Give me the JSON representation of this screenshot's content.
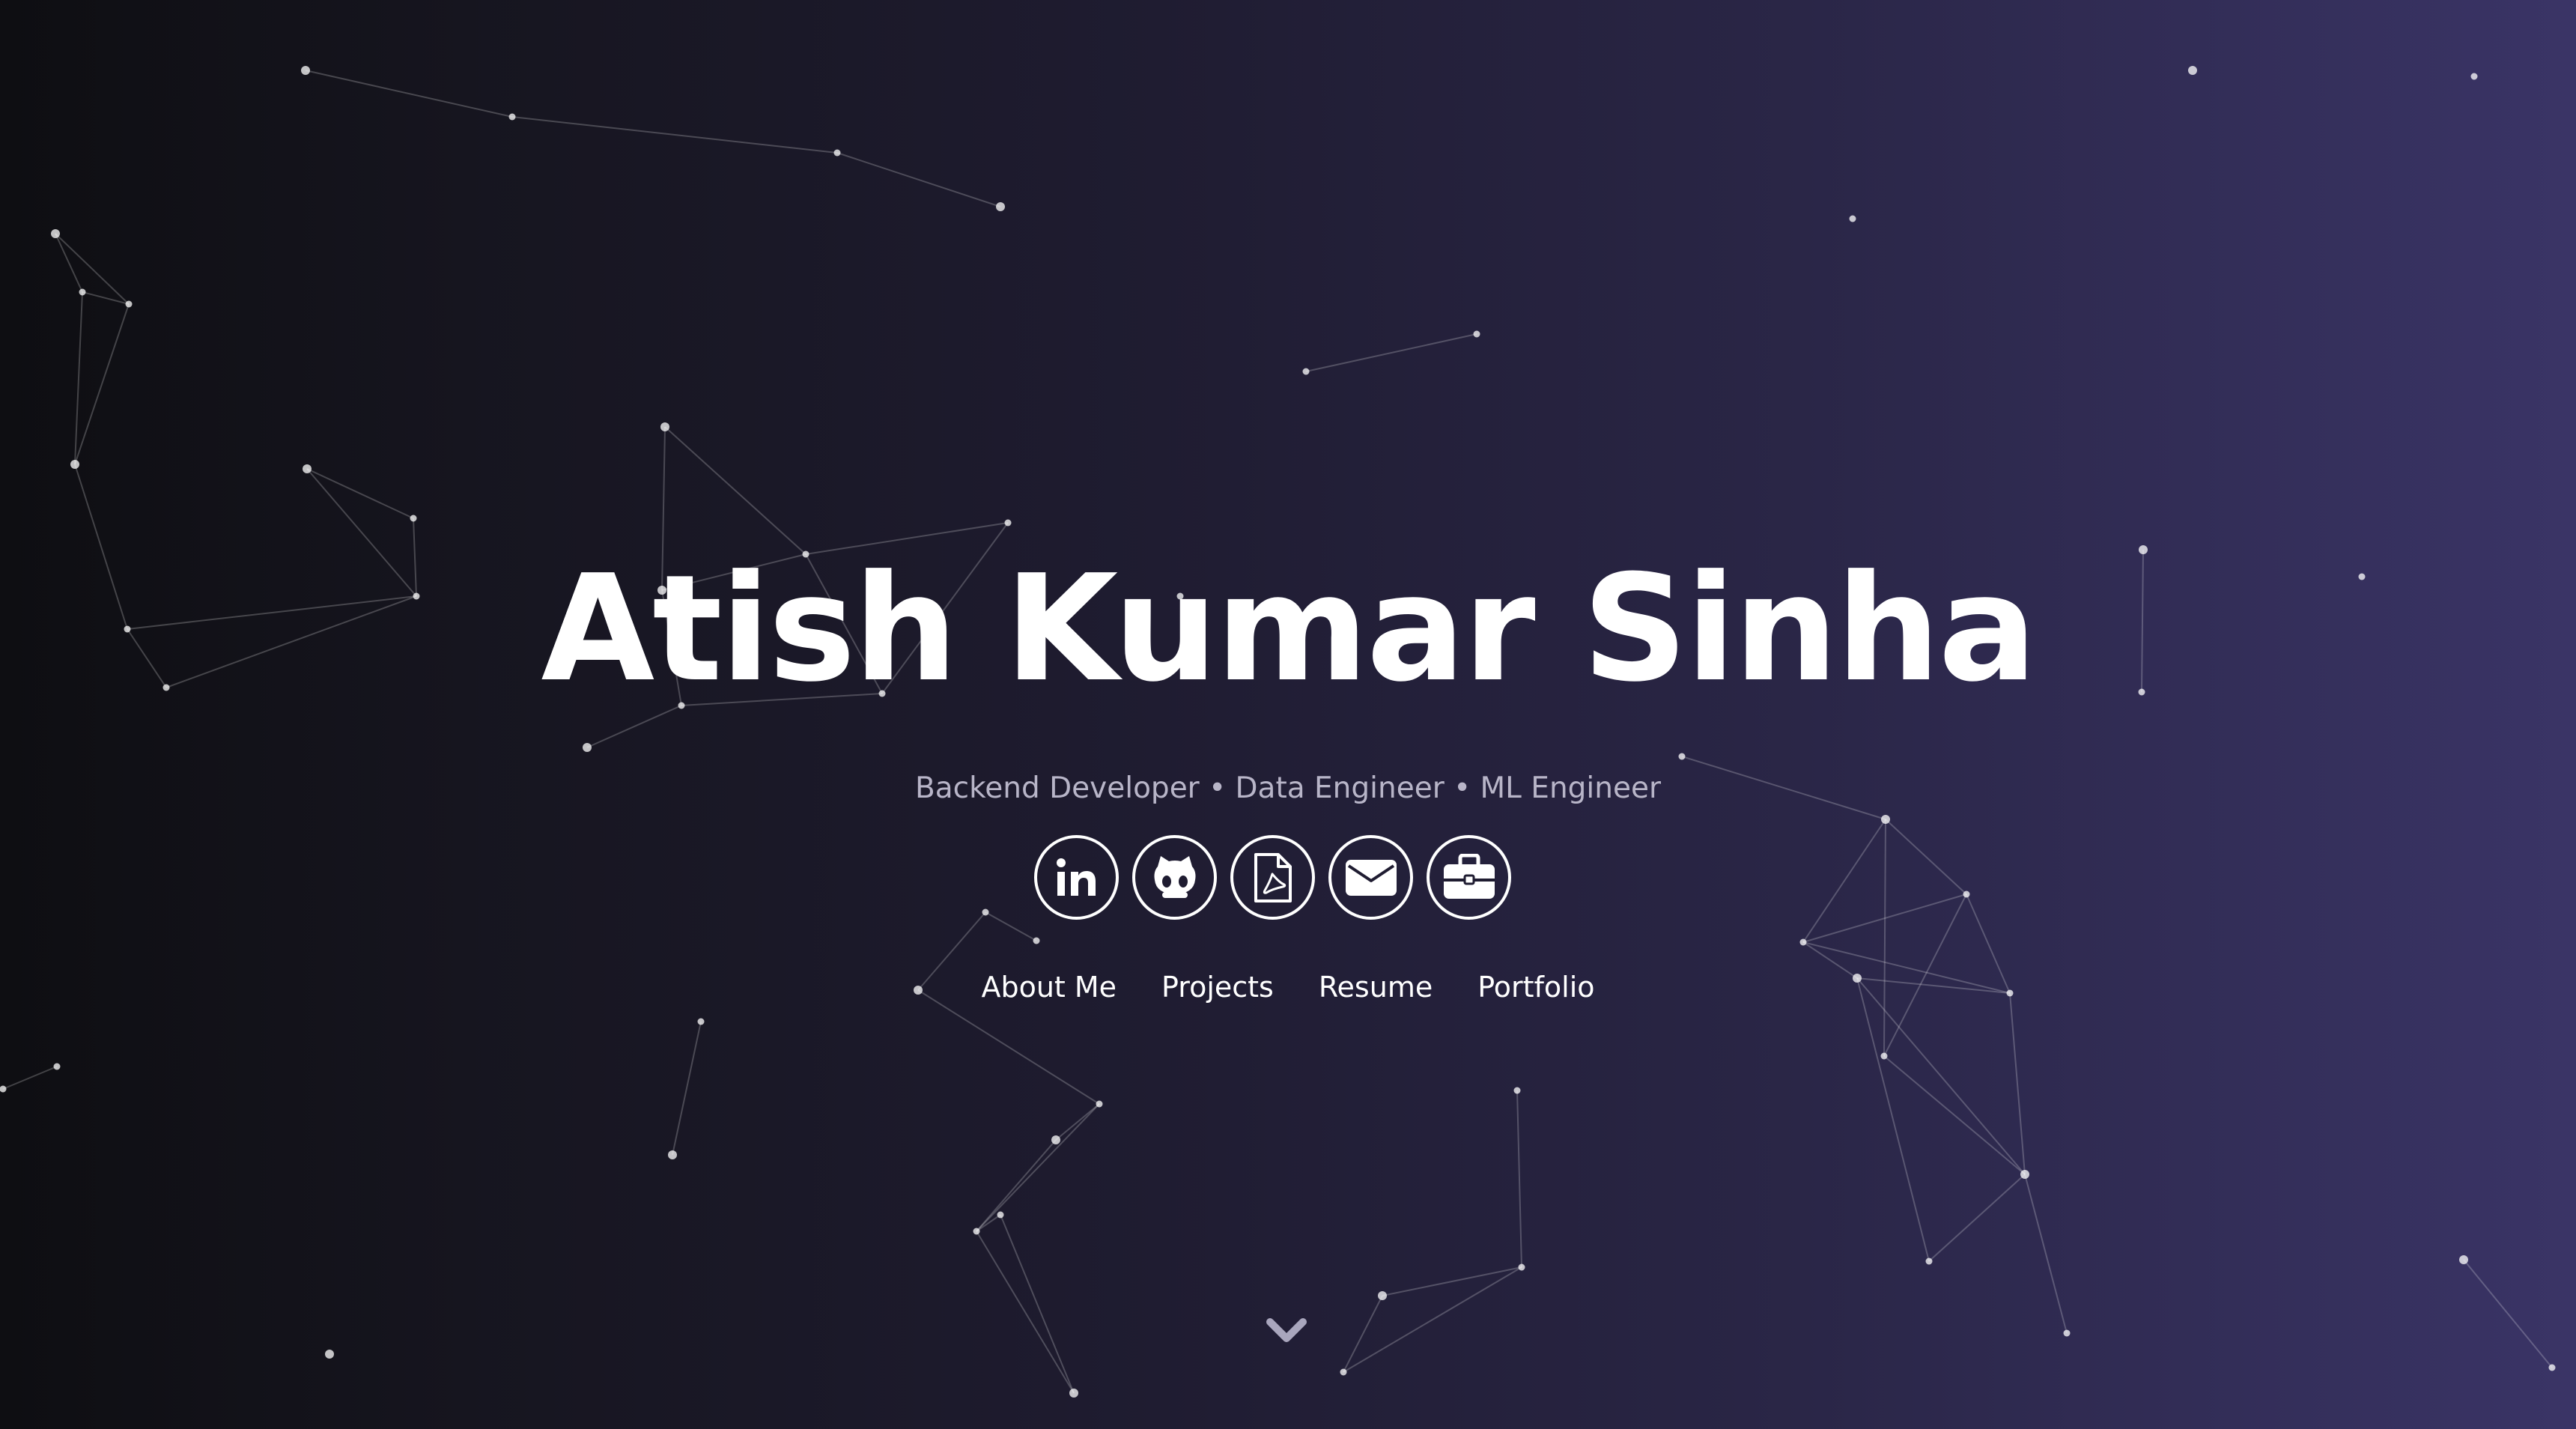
{
  "hero": {
    "name": "Atish Kumar Sinha",
    "tagline": "Backend Developer • Data Engineer • ML Engineer"
  },
  "socials": [
    {
      "icon": "linkedin-icon"
    },
    {
      "icon": "github-icon"
    },
    {
      "icon": "pdf-resume-icon"
    },
    {
      "icon": "email-icon"
    },
    {
      "icon": "briefcase-icon"
    }
  ],
  "nav": {
    "about_label": "About Me",
    "projects_label": "Projects",
    "resume_label": "Resume",
    "portfolio_label": "Portfolio"
  },
  "scroll": {
    "icon": "chevron-down-icon"
  },
  "colors": {
    "background_start": "#0e0e12",
    "background_end": "#3a3466",
    "text": "#ffffff",
    "subtitle": "#b8b5c8",
    "particles": "#ffffff"
  }
}
